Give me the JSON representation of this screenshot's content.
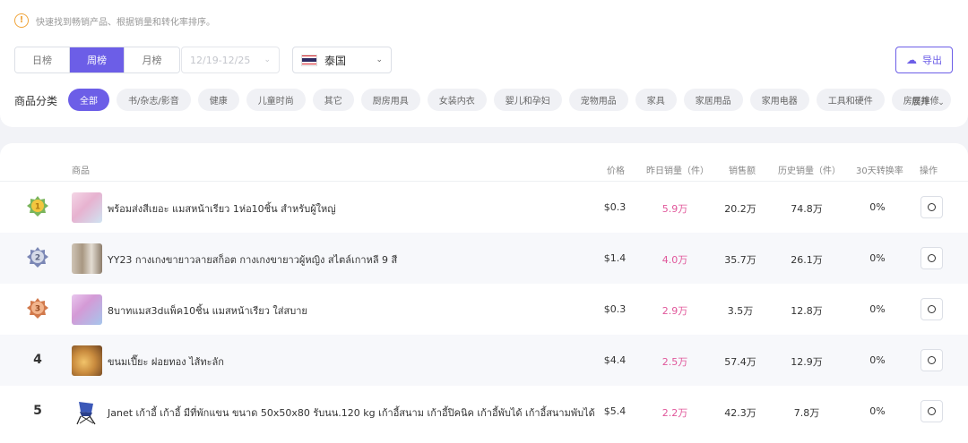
{
  "notice": {
    "icon": "exclamation-icon",
    "text": "快速找到畅销产品、根据销量和转化率排序。"
  },
  "period_tabs": [
    {
      "label": "日榜",
      "active": false
    },
    {
      "label": "周榜",
      "active": true
    },
    {
      "label": "月榜",
      "active": false
    }
  ],
  "date_select": {
    "value": "12/19-12/25",
    "icon": "chevron-down-icon"
  },
  "country_select": {
    "value": "泰国",
    "flag": "thailand-flag-icon",
    "flag_colors": [
      "#d72027",
      "#ffffff",
      "#2d2a61",
      "#ffffff",
      "#d72027"
    ]
  },
  "export_button": {
    "label": "导出",
    "icon": "cloud-export-icon"
  },
  "categories": {
    "label": "商品分类",
    "items": [
      {
        "label": "全部",
        "active": true
      },
      {
        "label": "书/杂志/影音",
        "active": false
      },
      {
        "label": "健康",
        "active": false
      },
      {
        "label": "儿童时尚",
        "active": false
      },
      {
        "label": "其它",
        "active": false
      },
      {
        "label": "厨房用具",
        "active": false
      },
      {
        "label": "女装内衣",
        "active": false
      },
      {
        "label": "婴儿和孕妇",
        "active": false
      },
      {
        "label": "宠物用品",
        "active": false
      },
      {
        "label": "家具",
        "active": false
      },
      {
        "label": "家居用品",
        "active": false
      },
      {
        "label": "家用电器",
        "active": false
      },
      {
        "label": "工具和硬件",
        "active": false
      },
      {
        "label": "房屋维修",
        "active": false
      }
    ],
    "expand_label": "展开",
    "expand_icon": "chevron-down-icon"
  },
  "table": {
    "columns": {
      "product": "商品",
      "price": "价格",
      "yesterday_sales": "昨日销量（件）",
      "revenue": "销售额",
      "history_sales": "历史销量（件）",
      "conversion": "30天转换率",
      "action": "操作"
    },
    "rows": [
      {
        "rank": "1",
        "medal": "gold-medal-icon",
        "name": "พร้อมส่งสีเยอะ แมสหน้าเรียว 1ห่อ10ชิ้น สำหรับผู้ใหญ่",
        "price": "$0.3",
        "yesterday_sales": "5.9万",
        "revenue": "20.2万",
        "history_sales": "74.8万",
        "conversion": "0%",
        "thumb_color": "#e7b2d0"
      },
      {
        "rank": "2",
        "medal": "silver-medal-icon",
        "name": "YY23 กางเกงขายาวลายสก็อต กางเกงขายาวผู้หญิง สไตล์เกาหลี 9 สี",
        "price": "$1.4",
        "yesterday_sales": "4.0万",
        "revenue": "35.7万",
        "history_sales": "26.1万",
        "conversion": "0%",
        "thumb_color": "#b9a996"
      },
      {
        "rank": "3",
        "medal": "bronze-medal-icon",
        "name": "8บาทแมส3dแพ็ค10ชิ้น แมสหน้าเรียว ใส่สบาย",
        "price": "$0.3",
        "yesterday_sales": "2.9万",
        "revenue": "3.5万",
        "history_sales": "12.8万",
        "conversion": "0%",
        "thumb_color": "#d49ad6"
      },
      {
        "rank": "4",
        "medal": "",
        "name": "ขนมเปี๊ยะ ฝอยทอง ไส้ทะลัก",
        "price": "$4.4",
        "yesterday_sales": "2.5万",
        "revenue": "57.4万",
        "history_sales": "12.9万",
        "conversion": "0%",
        "thumb_color": "#c98b3e"
      },
      {
        "rank": "5",
        "medal": "",
        "name": "Janet เก้าอี้ เก้าอี้ มีที่พักแขน ขนาด 50x50x80 รับนน.120 kg เก้าอี้สนาม เก้าอี้ปิคนิค เก้าอี้พับได้ เก้าอี้สนามพับได้",
        "price": "$5.4",
        "yesterday_sales": "2.2万",
        "revenue": "42.3万",
        "history_sales": "7.8万",
        "conversion": "0%",
        "thumb_color": "#3b58b8"
      }
    ],
    "action_icon": "search-circle-icon"
  },
  "colors": {
    "accent": "#6c5ee7",
    "sales_highlight": "#e0569a",
    "warning": "#f0a43a"
  }
}
